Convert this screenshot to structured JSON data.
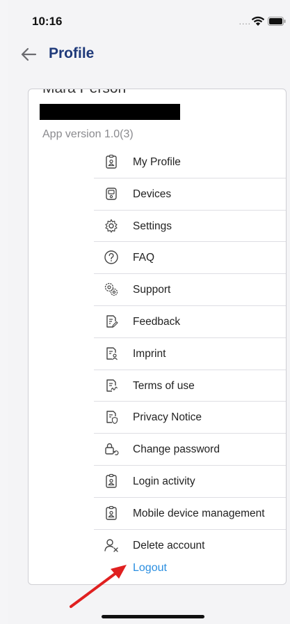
{
  "status_bar": {
    "time": "10:16",
    "signal_dots": "....",
    "wifi_icon": "wifi-icon",
    "battery_icon": "battery-icon"
  },
  "header": {
    "back_icon": "arrow-left-icon",
    "title": "Profile"
  },
  "profile": {
    "name": "Mara Person",
    "app_version": "App version 1.0(3)"
  },
  "menu": [
    {
      "label": "My Profile",
      "icon": "badge-icon"
    },
    {
      "label": "Devices",
      "icon": "device-icon"
    },
    {
      "label": "Settings",
      "icon": "gear-icon"
    },
    {
      "label": "FAQ",
      "icon": "question-icon"
    },
    {
      "label": "Support",
      "icon": "support-gears-icon"
    },
    {
      "label": "Feedback",
      "icon": "document-edit-icon"
    },
    {
      "label": "Imprint",
      "icon": "document-person-icon"
    },
    {
      "label": "Terms of use",
      "icon": "document-sign-icon"
    },
    {
      "label": "Privacy Notice",
      "icon": "document-shield-icon"
    },
    {
      "label": "Change password",
      "icon": "lock-refresh-icon"
    },
    {
      "label": "Login activity",
      "icon": "badge-icon"
    },
    {
      "label": "Mobile device management",
      "icon": "badge-icon"
    },
    {
      "label": "Delete account",
      "icon": "user-remove-icon"
    }
  ],
  "logout_label": "Logout",
  "colors": {
    "accent": "#2a8ee0",
    "title": "#1f3a7a",
    "annotation_arrow": "#e02020"
  }
}
